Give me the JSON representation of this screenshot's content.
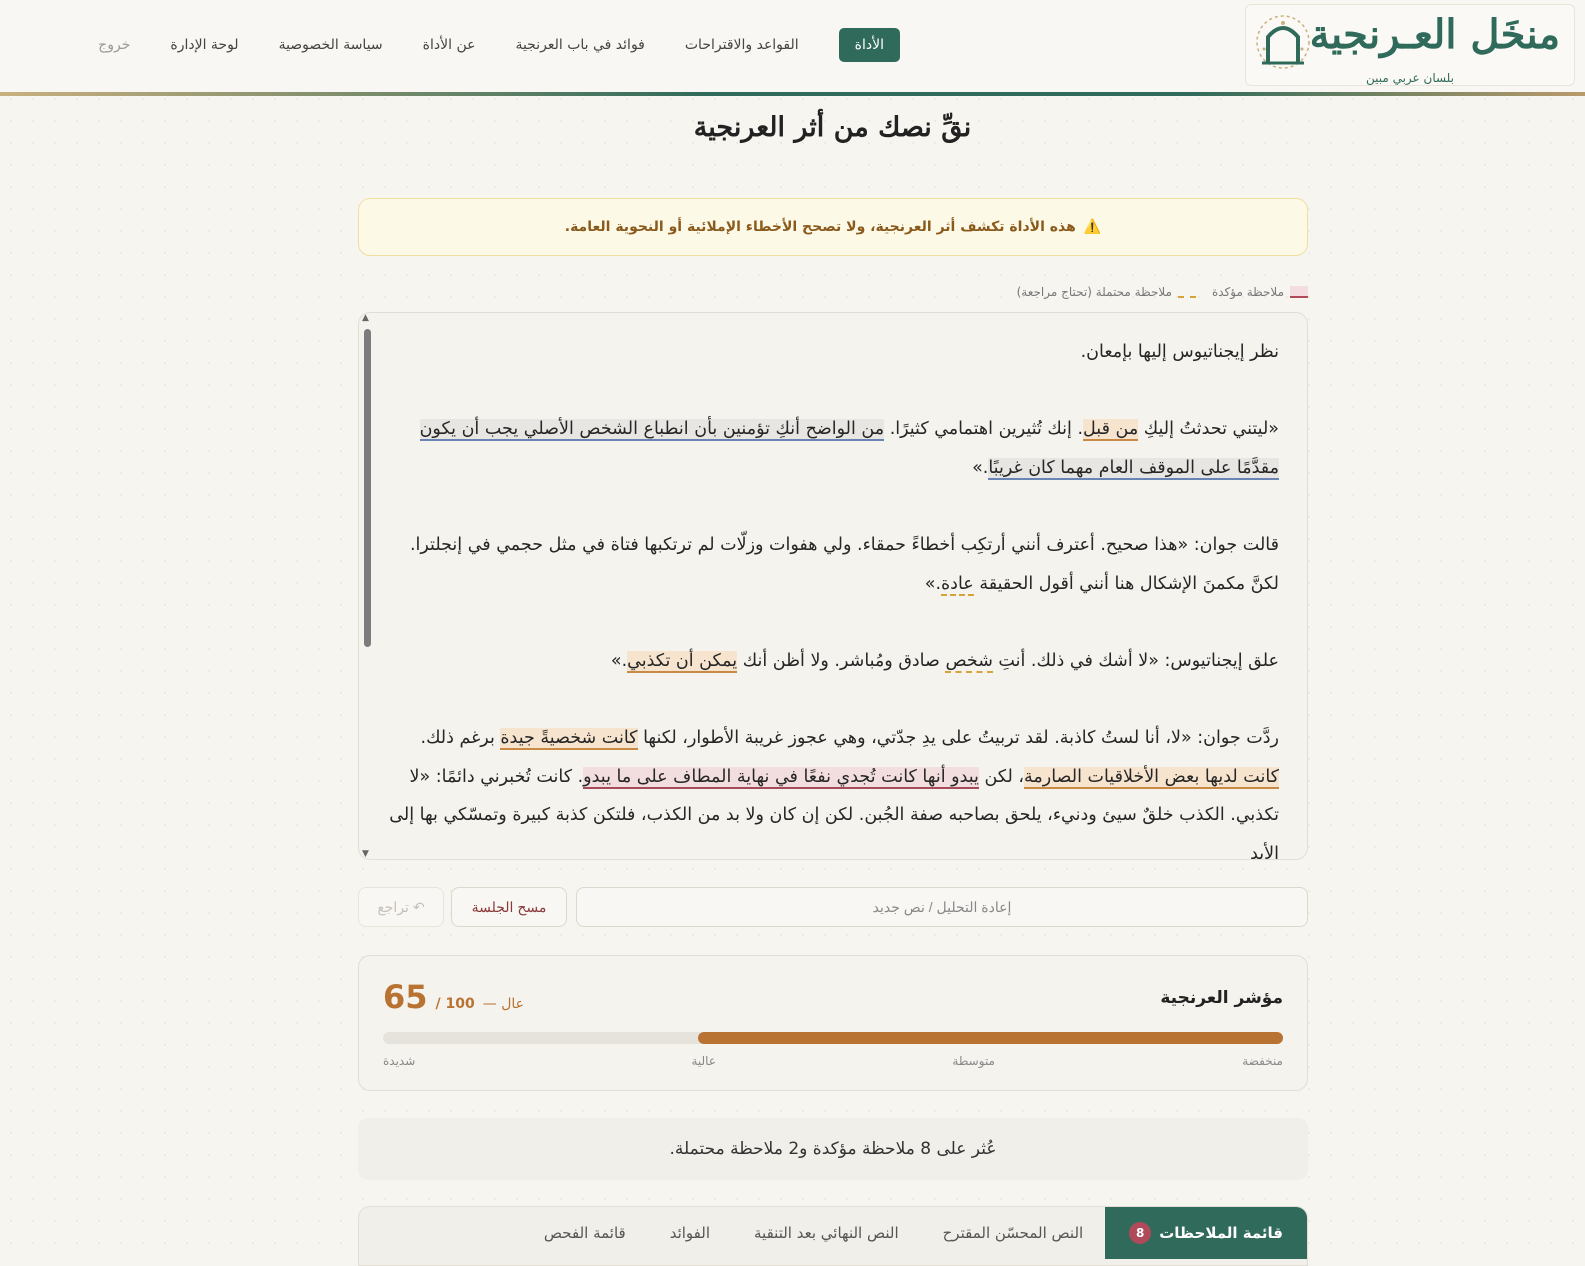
{
  "brand": {
    "title": "منخَل العـرنجية",
    "tagline": "بلسان عربي مبين"
  },
  "nav": {
    "items": [
      {
        "label": "الأداة",
        "active": true
      },
      {
        "label": "القواعد والاقتراحات"
      },
      {
        "label": "فوائد في باب العرنجية"
      },
      {
        "label": "عن الأداة"
      },
      {
        "label": "سياسة الخصوصية"
      },
      {
        "label": "لوحة الإدارة"
      },
      {
        "label": "خروج"
      }
    ]
  },
  "page": {
    "title": "نقِّ نصك من أثر العرنجية"
  },
  "warning": {
    "icon": "⚠️",
    "text": "هذه الأداة تكشف أثر العرنجية، ولا تصحح الأخطاء الإملائية أو النحوية العامة."
  },
  "legend": {
    "confirmed": "ملاحظة مؤكدة",
    "possible": "ملاحظة محتملة (تحتاج مراجعة)"
  },
  "editor": {
    "p1": "نظر إيجناتيوس إليها بإمعان.",
    "p2": {
      "a": "«ليتني تحدثتُ إليكِ ",
      "b": "من قبل",
      "c": ". إنك تُثيرين اهتمامي كثيرًا. ",
      "d": "من الواضح أنكِ تؤمنين بأن انطباع الشخص الأصلي يجب أن يكون مقدَّمًا على الموقف العام مهما كان غريبًا",
      "e": ".»"
    },
    "p3": {
      "a": "قالت جوان: «هذا صحيح. أعترف أنني أرتكِب أخطاءً حمقاء. ولي هفوات وزلّات لم ترتكبها فتاة في مثل حجمي في إنجلترا. لكنَّ مكمنَ الإشكال هنا أنني أقول الحقيقة ",
      "b": "عادة",
      "c": ".»"
    },
    "p4": {
      "a": "علق إيجناتيوس: «لا أشك في ذلك. أنتِ ",
      "b": "شخص",
      "c": " صادق ومُباشر. ولا أظن أنك ",
      "d": "يمكن أن تكذبي",
      "e": ".»"
    },
    "p5": {
      "a": "ردَّت جوان: «لا، أنا لستُ كاذبة. لقد تربيتُ على يدِ جدّتي، وهي عجوز غريبة الأطوار، لكنها ",
      "b": "كانت شخصيةً جيدة",
      "c": " برغم ذلك. ",
      "d": "كانت لديها بعض الأخلاقيات الصارمة",
      "e": "، لكن ",
      "f": "يبدو أنها كانت تُجدي نفعًا في نهاية المطاف على ما يبدو",
      "g": ". كانت تُخبرني دائمًا: «لا تكذبي. الكذب خلقٌ سيئ ودنيء، يلحق بصاحبه صفة الجُبن. لكن إن كان ولا بد من الكذب، فلتكن كذبة كبيرة وتمسّكي بها إلى الأبد"
    }
  },
  "actions": {
    "reanalyze": "إعادة التحليل / نص جديد",
    "clear": "مسح الجلسة",
    "undo": "تراجع",
    "undo_icon": "↶"
  },
  "score": {
    "label": "مؤشر العرنجية",
    "value": "65",
    "max": "/ 100",
    "level": "— عال",
    "fraction": 0.65,
    "scale": [
      "منخفضة",
      "متوسطة",
      "عالية",
      "شديدة"
    ]
  },
  "summary": {
    "text": "عُثر على 8 ملاحظة مؤكدة و2 ملاحظة محتملة."
  },
  "tabs": [
    {
      "label": "قائمة الملاحظات",
      "badge": "8",
      "active": true
    },
    {
      "label": "النص المحسّن المقترح"
    },
    {
      "label": "النص النهائي بعد التنقية"
    },
    {
      "label": "الفوائد"
    },
    {
      "label": "قائمة الفحص"
    }
  ],
  "colors": {
    "primary": "#2f6a5a",
    "accent": "#b87333",
    "confirmed": "#b04a5a",
    "possible": "#d7a23a"
  }
}
